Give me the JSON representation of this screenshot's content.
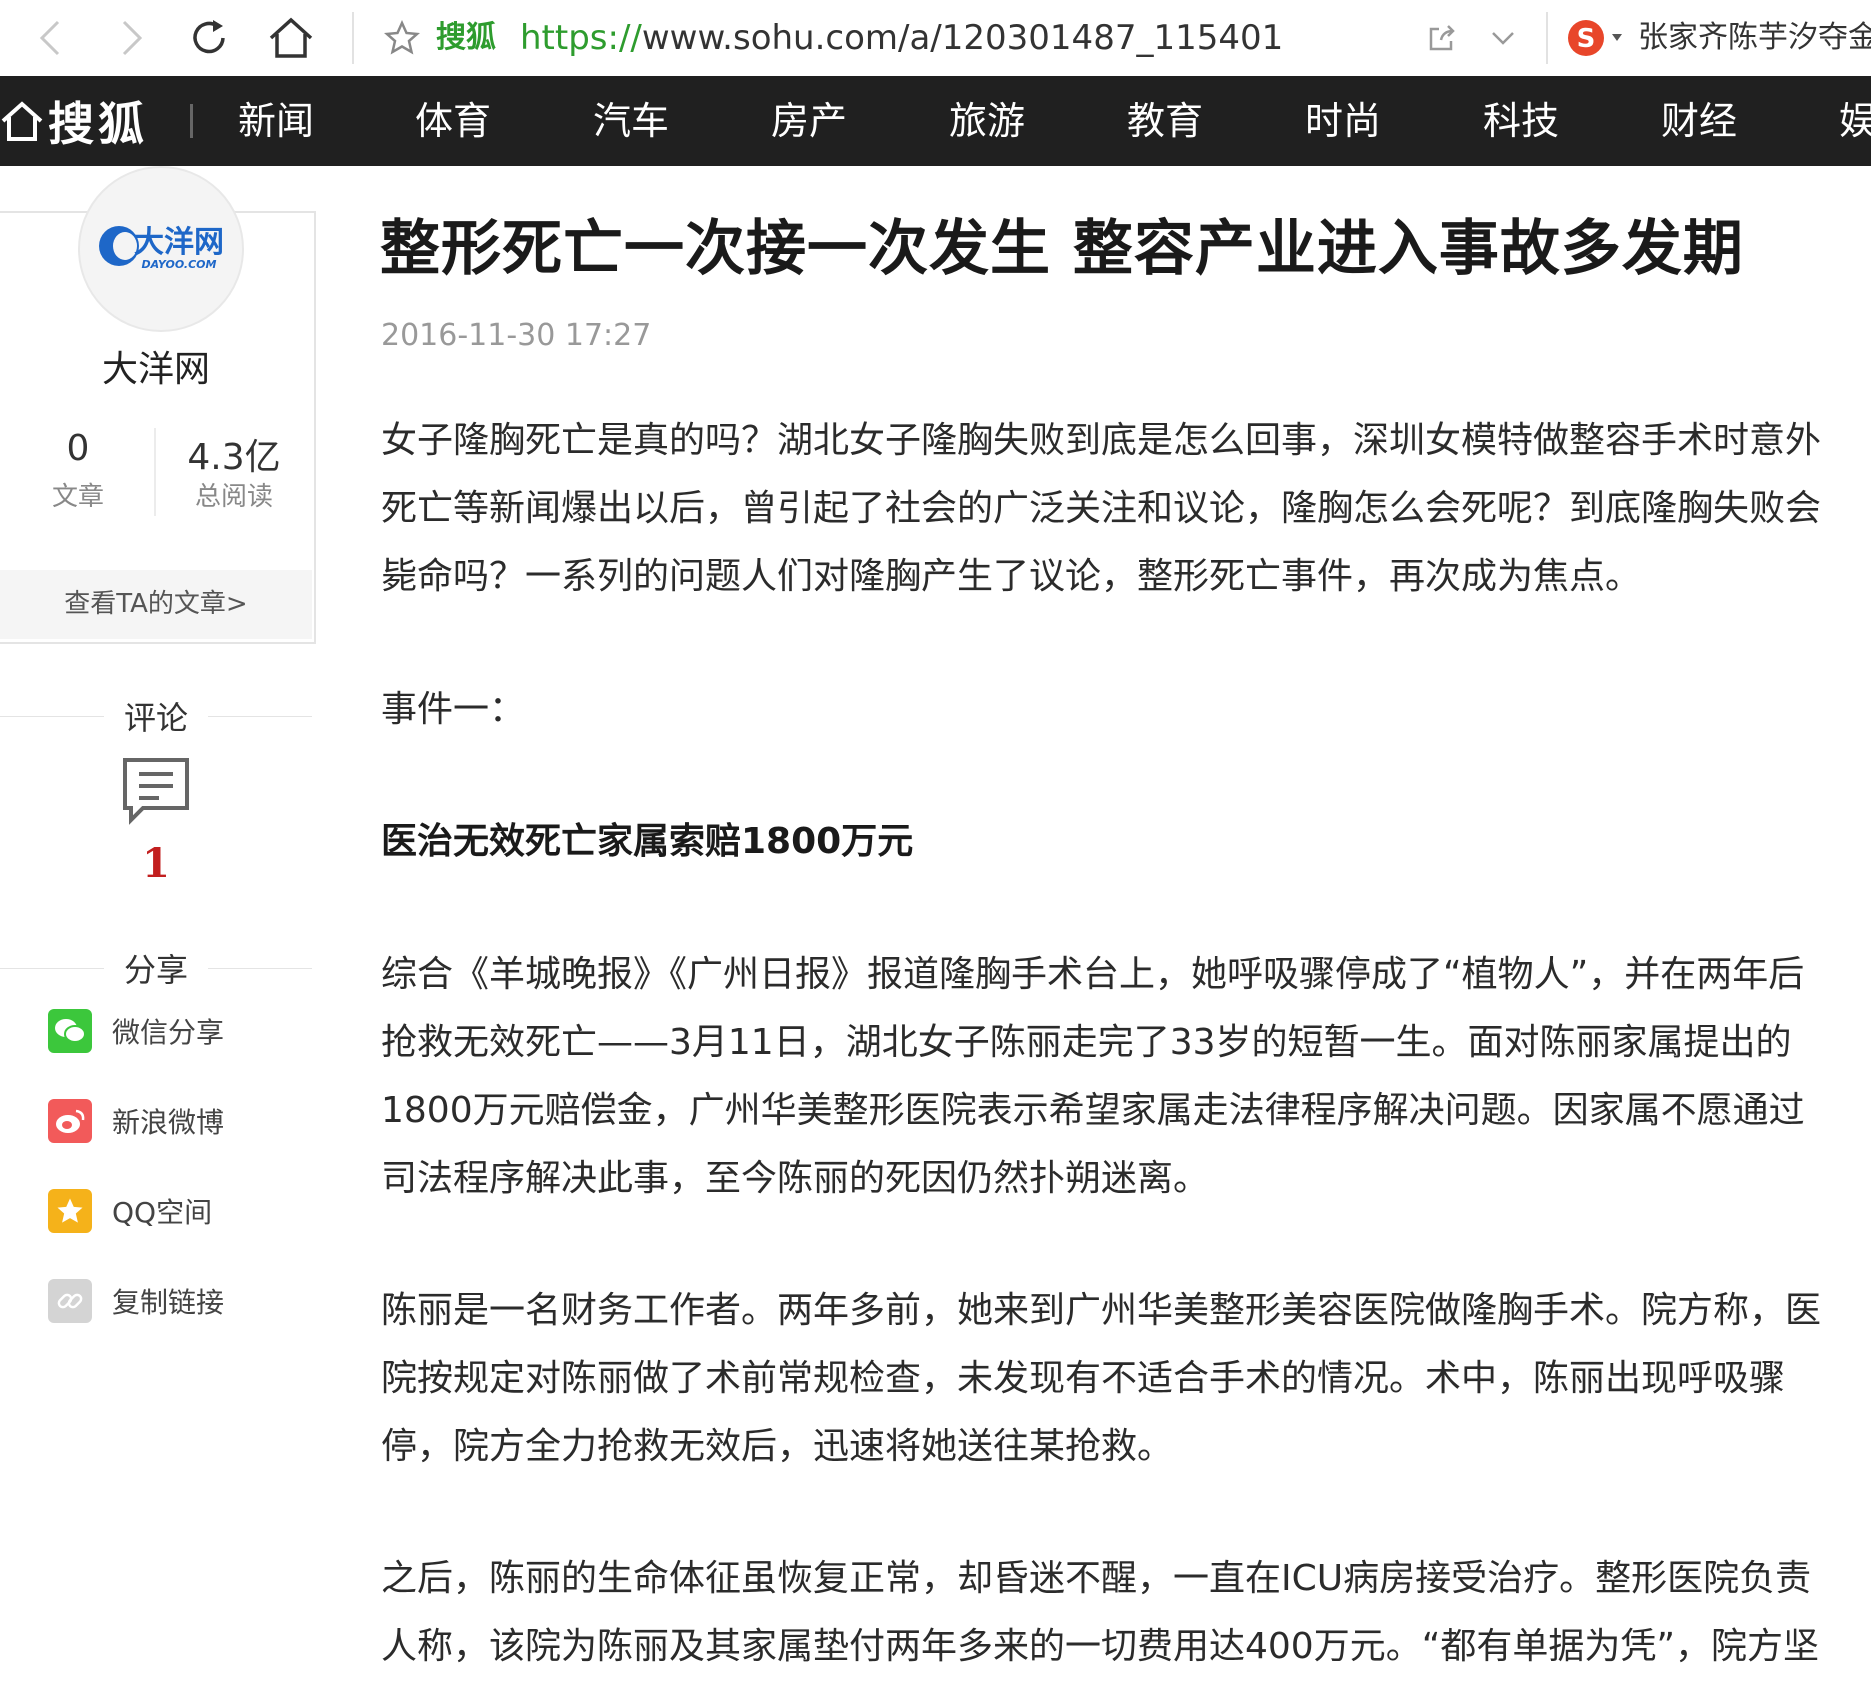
{
  "browser": {
    "site_name": "搜狐",
    "url_scheme": "https://",
    "url_rest": "www.sohu.com/a/120301487_115401",
    "search_hint": "张家齐陈芋汐夺金"
  },
  "nav": {
    "logo": "搜狐",
    "items": [
      "新闻",
      "体育",
      "汽车",
      "房产",
      "旅游",
      "教育",
      "时尚",
      "科技",
      "财经",
      "娱"
    ]
  },
  "author": {
    "avatar_text": "大洋网",
    "avatar_sub": "DAYOO.COM",
    "name": "大洋网",
    "articles_count": "0",
    "articles_label": "文章",
    "reads_count": "4.3亿",
    "reads_label": "总阅读",
    "view_articles": "查看TA的文章>"
  },
  "comments": {
    "heading": "评论",
    "count": "1"
  },
  "share": {
    "heading": "分享",
    "items": [
      {
        "label": "微信分享",
        "icon": "wechat-icon",
        "color": "#3cc73c"
      },
      {
        "label": "新浪微博",
        "icon": "weibo-icon",
        "color": "#f25a5a"
      },
      {
        "label": "QQ空间",
        "icon": "qzone-icon",
        "color": "#f5b21a"
      },
      {
        "label": "复制链接",
        "icon": "link-icon",
        "color": "#d4d4d4"
      }
    ]
  },
  "article": {
    "title": "整形死亡一次接一次发生 整容产业进入事故多发期",
    "date": "2016-11-30 17:27",
    "paragraphs": [
      "女子隆胸死亡是真的吗？湖北女子隆胸失败到底是怎么回事，深圳女模特做整容手术时意外死亡等新闻爆出以后，曾引起了社会的广泛关注和议论，隆胸怎么会死呢？到底隆胸失败会毙命吗？一系列的问题人们对隆胸产生了议论，整形死亡事件，再次成为焦点。",
      "事件一：",
      "医治无效死亡家属索赔1800万元",
      "综合《羊城晚报》《广州日报》报道隆胸手术台上，她呼吸骤停成了“植物人”，并在两年后抢救无效死亡——3月11日，湖北女子陈丽走完了33岁的短暂一生。面对陈丽家属提出的1800万元赔偿金，广州华美整形医院表示希望家属走法律程序解决问题。因家属不愿通过司法程序解决此事，至今陈丽的死因仍然扑朔迷离。",
      "陈丽是一名财务工作者。两年多前，她来到广州华美整形美容医院做隆胸手术。院方称，医院按规定对陈丽做了术前常规检查，未发现有不适合手术的情况。术中，陈丽出现呼吸骤停，院方全力抢救无效后，迅速将她送往某抢救。",
      "之后，陈丽的生命体征虽恢复正常，却昏迷不醒，一直在ICU病房接受治疗。整形医院负责人称，该院为陈丽及其家属垫付两年多来的一切费用达400万元。“都有单据为凭”，院方坚"
    ]
  },
  "colors": {
    "nav_bg": "#202020",
    "accent_green": "#2e9c2e",
    "comment_count": "#c21f1f"
  }
}
